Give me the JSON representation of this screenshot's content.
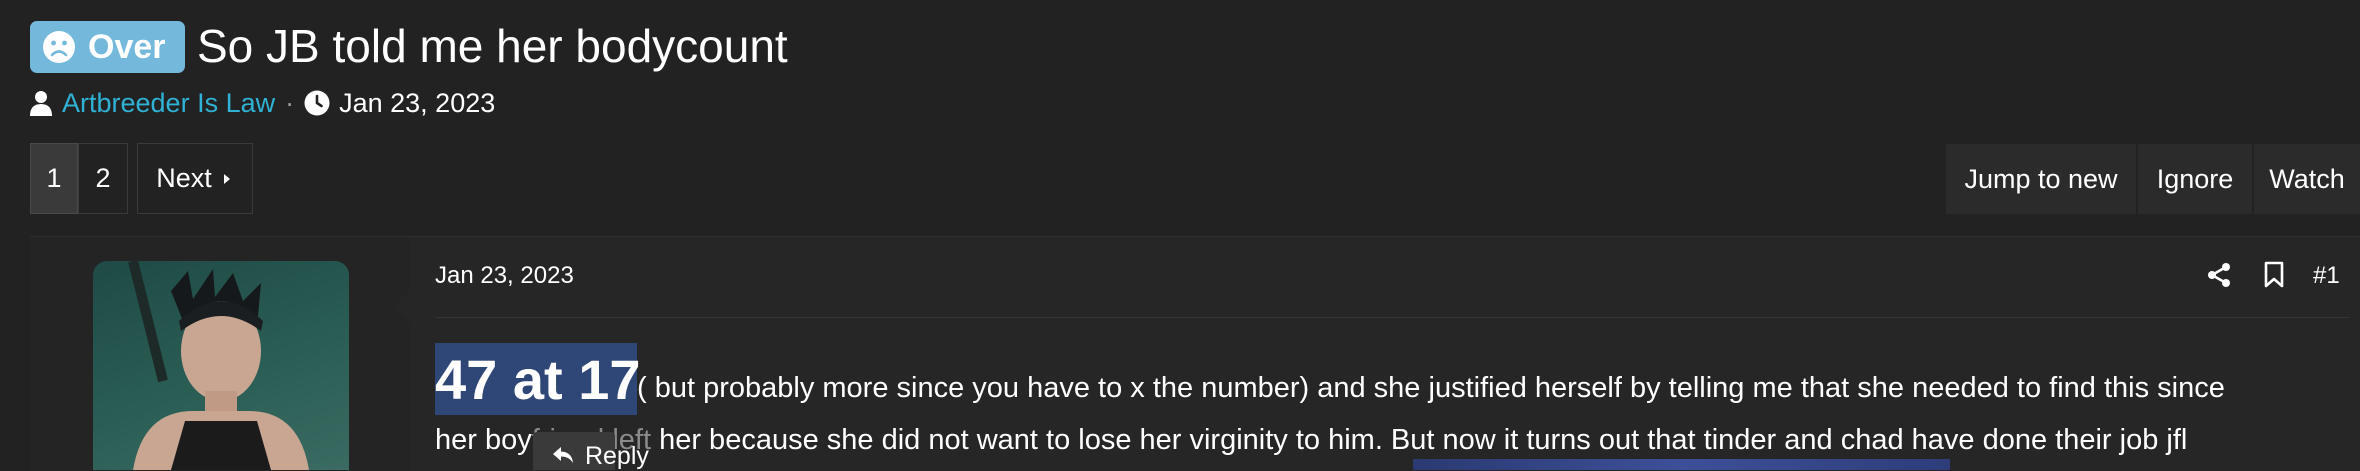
{
  "thread": {
    "badge_label": "Over",
    "title": "So JB told me her bodycount",
    "author": "Artbreeder Is Law",
    "separator": "·",
    "date": "Jan 23, 2023"
  },
  "pagination": {
    "pages": [
      "1",
      "2"
    ],
    "current_page": "1",
    "next_label": "Next"
  },
  "toolbar": {
    "jump_label": "Jump to new",
    "ignore_label": "Ignore",
    "watch_label": "Watch"
  },
  "post": {
    "date": "Jan 23, 2023",
    "number": "#1",
    "highlight_text": "47 at 17",
    "line1_rest": "( but probably more since you have to x the number) and she justified herself by telling me that she needed to find this since",
    "line2_start": "her boy",
    "line2_faded": "friend left",
    "line2_rest": " her because she did not want to lose her virginity to him. But now it turns out that tinder and chad have done their job jfl",
    "reply_label": "Reply"
  },
  "colors": {
    "background": "#222222",
    "badge": "#74b9dc",
    "link": "#2fb2d6",
    "selection": "#2f4777"
  }
}
